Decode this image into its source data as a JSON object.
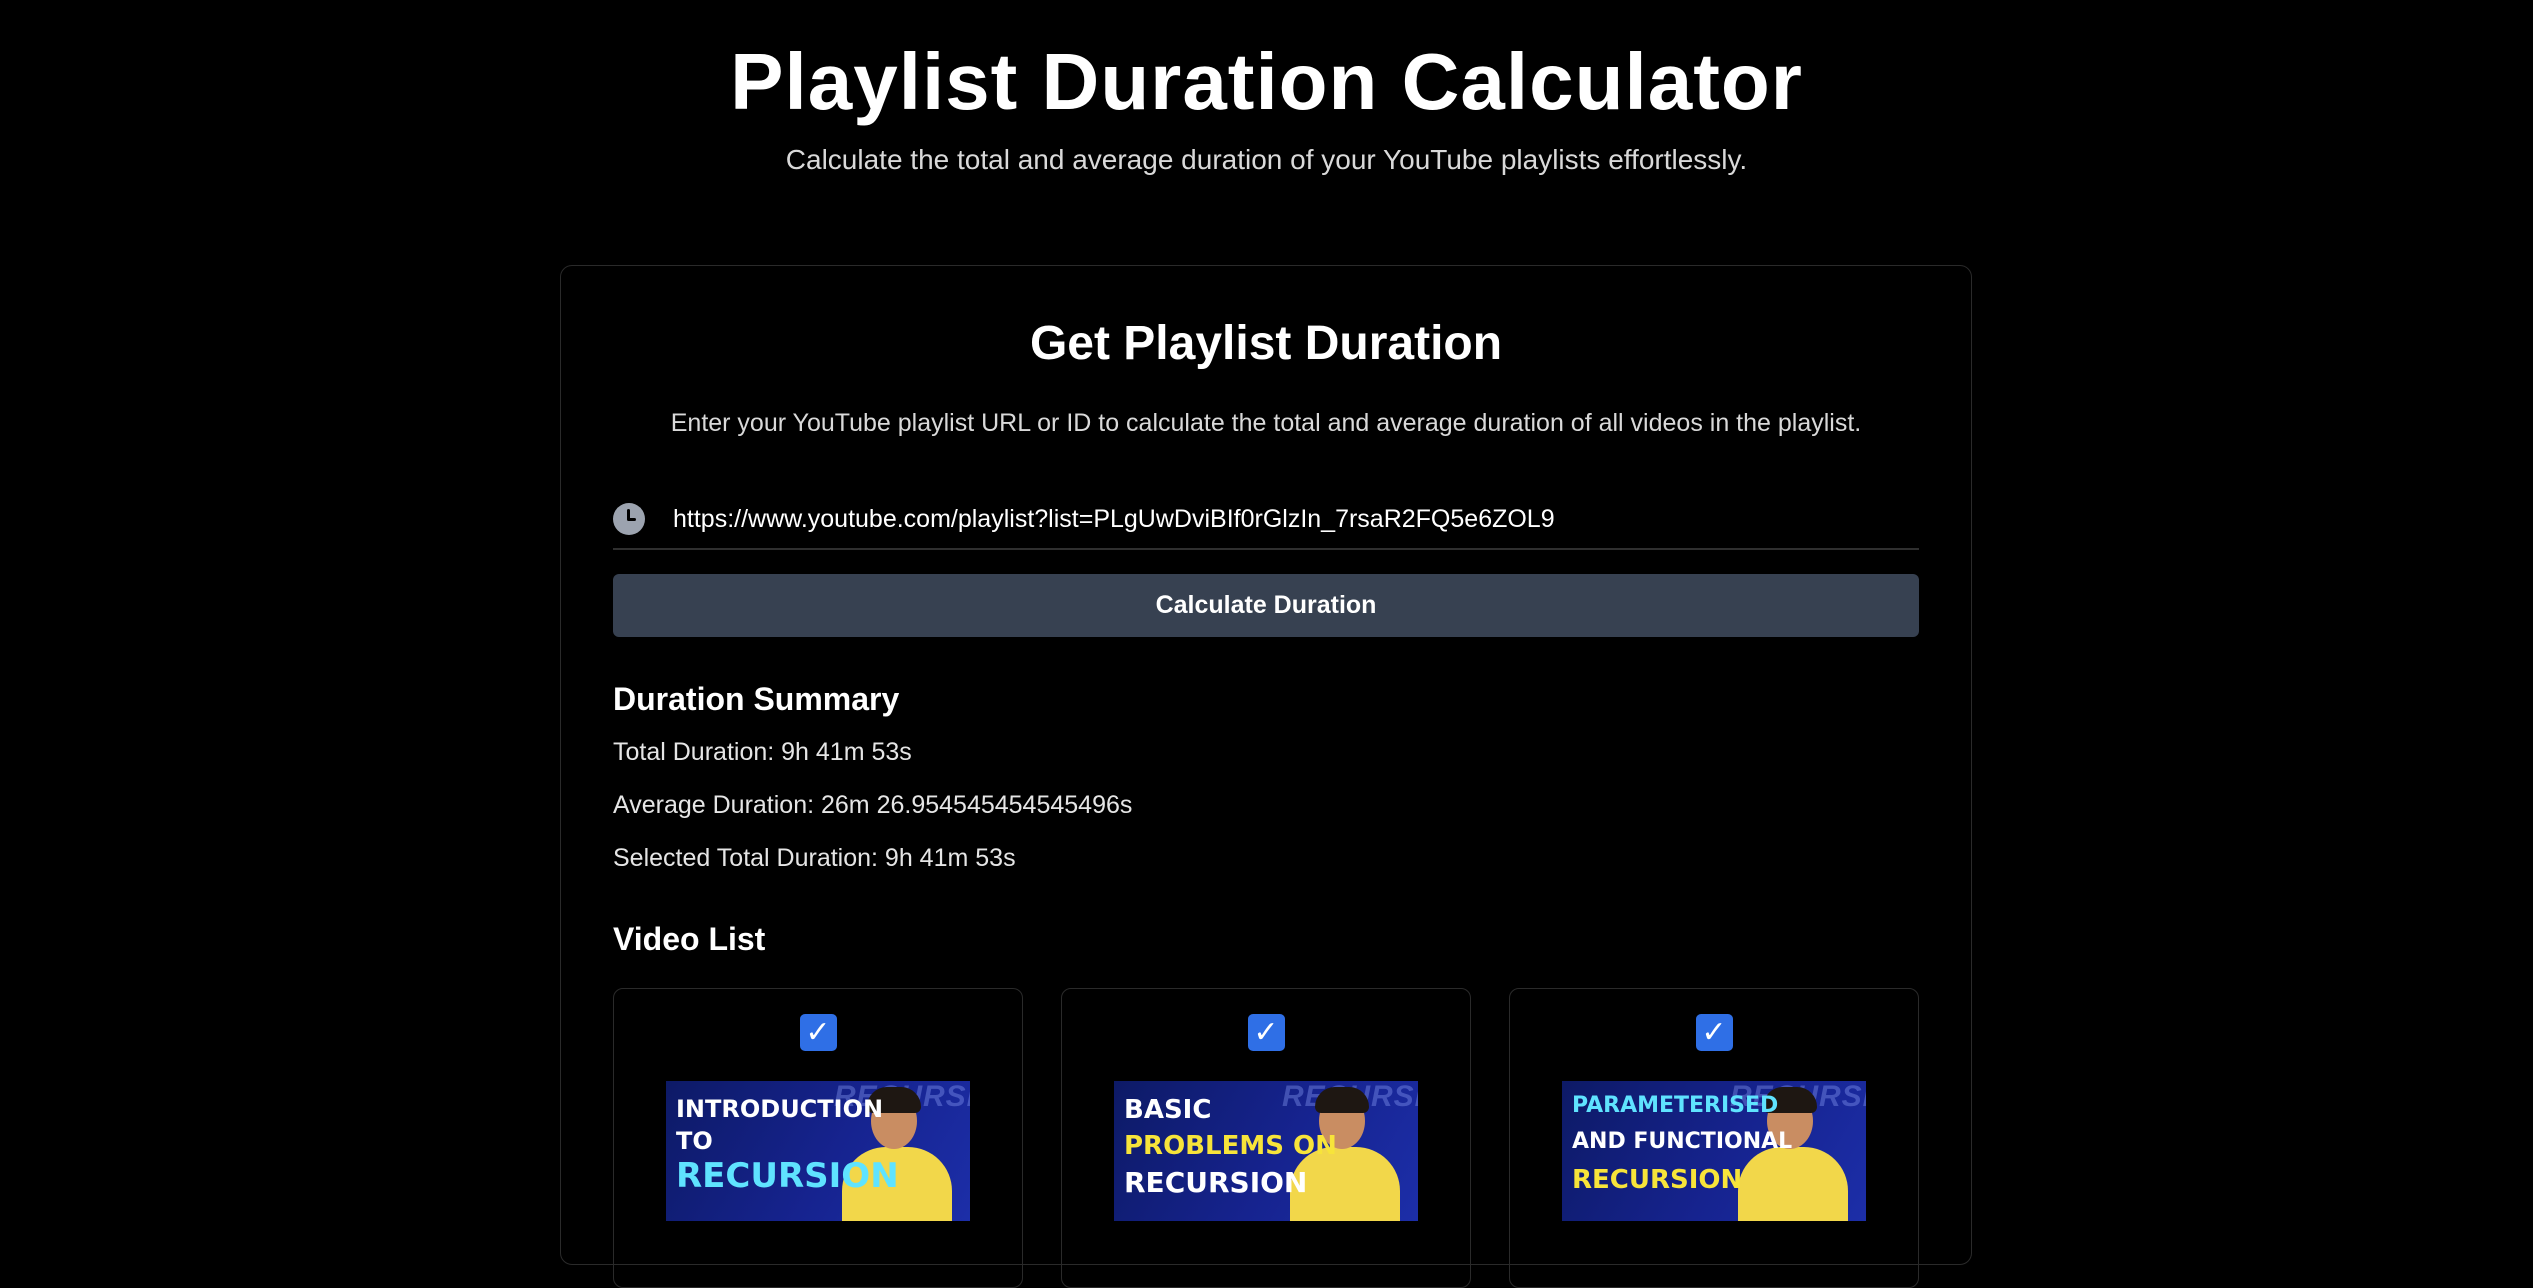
{
  "header": {
    "title": "Playlist Duration Calculator",
    "subtitle": "Calculate the total and average duration of your YouTube playlists effortlessly."
  },
  "card": {
    "title": "Get Playlist Duration",
    "description": "Enter your YouTube playlist URL or ID to calculate the total and average duration of all videos in the playlist.",
    "input_value": "https://www.youtube.com/playlist?list=PLgUwDviBIf0rGlzIn_7rsaR2FQ5e6ZOL9",
    "button_label": "Calculate Duration"
  },
  "summary": {
    "heading": "Duration Summary",
    "total": "Total Duration: 9h 41m 53s",
    "average": "Average Duration: 26m 26.954545454545496s",
    "selected": "Selected Total Duration: 9h 41m 53s"
  },
  "videos": {
    "heading": "Video List",
    "items": [
      {
        "checked": true,
        "line1": "INTRODUCTION",
        "line2": "TO",
        "line3": "RECURSION"
      },
      {
        "checked": true,
        "line1": "BASIC",
        "line2": "PROBLEMS ON",
        "line3": "RECURSION"
      },
      {
        "checked": true,
        "line1": "PARAMETERISED",
        "line2": "AND FUNCTIONAL",
        "line3": "RECURSION"
      }
    ],
    "watermark": "RECURSI"
  },
  "colors": {
    "background": "#000000",
    "button": "#374151",
    "checkbox": "#2f6fe6",
    "thumb_blue": "#16238f",
    "thumb_yellow": "#f7e43a",
    "thumb_cyan": "#5fe3ff"
  },
  "icons": {
    "input": "clock-icon",
    "checkbox": "checkmark-icon"
  }
}
